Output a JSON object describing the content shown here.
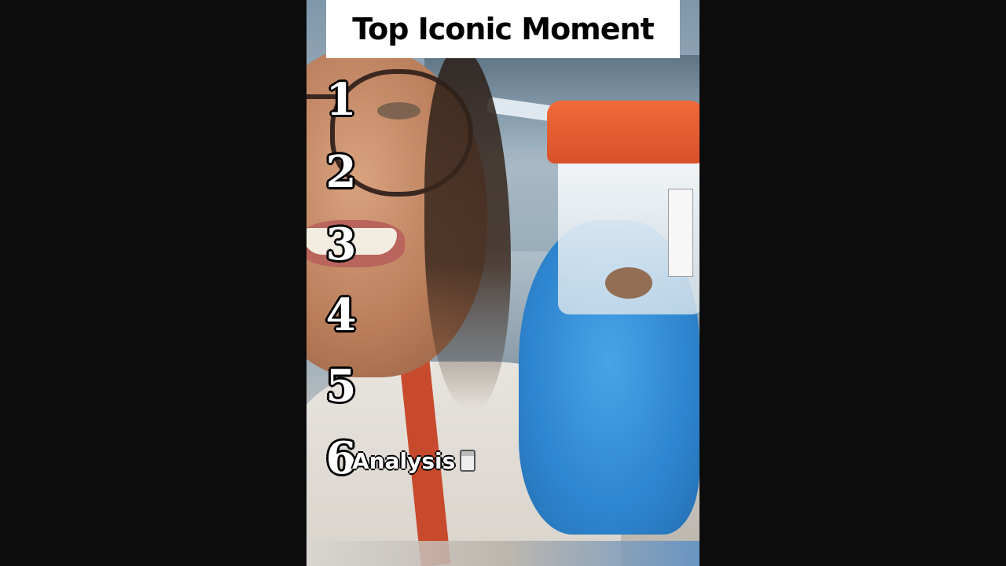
{
  "title": "Top Iconic Moment",
  "ranks": [
    "1",
    "2",
    "3",
    "4",
    "5",
    "6"
  ],
  "answers": {
    "rank6": "Analysis"
  },
  "icons": {
    "answer_icon": "specimen-jar-icon"
  },
  "colors": {
    "background": "#0c0c0c",
    "title_bg": "#ffffff",
    "title_text": "#000000",
    "overlay_text": "#ffffff"
  }
}
